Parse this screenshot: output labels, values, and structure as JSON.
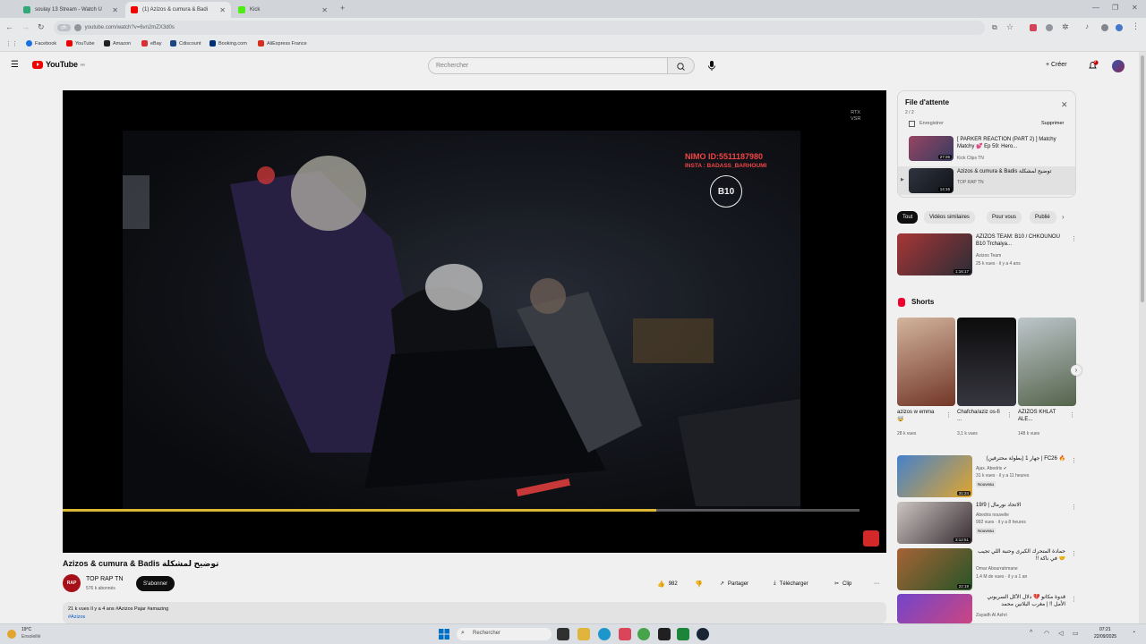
{
  "browser": {
    "tabs": [
      {
        "label": "soulay 13 Stream - Watch U",
        "color": "#36b37e"
      },
      {
        "label": "(1) Azizos & cumura & Badi",
        "color": "#ff0000"
      },
      {
        "label": "Kick",
        "color": "#53fc18"
      }
    ],
    "new_tab": "+",
    "url_chip": "gfk",
    "url": "youtube.com/watch?v=6vn2mZX3d0s",
    "bookmarks": [
      {
        "label": "Facebook",
        "color": "#1877f2"
      },
      {
        "label": "YouTube",
        "color": "#ff0000"
      },
      {
        "label": "Amazon",
        "color": "#222222"
      },
      {
        "label": "eBay",
        "color": "#e53238"
      },
      {
        "label": "Cdiscount",
        "color": "#1c4a8c"
      },
      {
        "label": "Booking.com",
        "color": "#003580"
      },
      {
        "label": "AliExpress France",
        "color": "#e43225"
      }
    ]
  },
  "header": {
    "logo": "YouTube",
    "logo_sup": "FR",
    "search_placeholder": "Rechercher",
    "create": "+ Créer",
    "notif_count": "9"
  },
  "player": {
    "rtx_badge": "RTX\nVSR",
    "overlay_id": "NIMO ID:5511187980",
    "overlay_insta": "INSTA : BADASS_BARHOUMI",
    "overlay_logo": "B10",
    "progress": 0.745
  },
  "video": {
    "title": "Azizos & cumura & Badis توضيح لمشكلة",
    "channel": "TOP RAP TN",
    "subs": "576 k abonnés",
    "avatar": "RAP",
    "subscribe": "S'abonner",
    "likes": "982",
    "share": "Partager",
    "download": "Télécharger",
    "clip": "Clip",
    "meta": "21 k vues  Il y a 4 ans  #Azizos Pajar #amazing",
    "hashtag": "#Azizos"
  },
  "queue": {
    "title": "File d'attente",
    "count": "2 / 2",
    "save": "Enregistrer",
    "remove": "Supprimer",
    "items": [
      {
        "title": "[ PARKER REACTION (PART 2) ] Matchy Matchy 💕 Ep 59: Hero...",
        "channel": "Kick Clips TN",
        "time": "27:26"
      },
      {
        "title": "Azizos & cumura & Badis توضيح لمشكلة",
        "channel": "TOP RAP TN",
        "time": "14:16"
      }
    ]
  },
  "filters": [
    "Tout",
    "Vidéos similaires",
    "Pour vous",
    "Publié"
  ],
  "recommend_top": {
    "title": "AZIZOS TEAM: B10 / CHKOUNOU B10 Trchaiya...",
    "channel": "Azizos Team",
    "meta": "25 k vues · il y a 4 ans",
    "time": "1:16:17"
  },
  "shorts": {
    "title": "Shorts",
    "items": [
      {
        "title": "azizos w emma 🤯",
        "views": "28 k vues"
      },
      {
        "title": "Chafcha/aziz os-fi ...",
        "views": "3,1 k vues"
      },
      {
        "title": "AZIZOS KHLAT ALE...",
        "views": "148 k vues"
      }
    ]
  },
  "recommend": [
    {
      "title": "🔥 FC26 | جهار 1 (بطولة محترفين)",
      "channel": "Ajax. Abedris ✔",
      "meta": "31 k vues · il y a 11 heures",
      "badge": "Nouveau",
      "time": "31:24"
    },
    {
      "title": "19/9 | الاتحاد نورمال",
      "channel": "Abedris nouvelle",
      "meta": "992 vues · il y a 8 heures",
      "badge": "Nouveau",
      "time": "3:12:51"
    },
    {
      "title": "حمادة المتحرك الكبرى وحنبة اللي تجيب 🤝 في ناكة !!",
      "channel": "Omar Abourrahmane",
      "meta": "1,4 M de vues · il y a 1 an",
      "badge": "",
      "time": "22:19"
    },
    {
      "title": "قدوة مكانو 💔 دلال الأكل السربوني الأمل !! | مغرب البلاتين محمد",
      "channel": "Zayadh Al Ashri",
      "meta": "",
      "badge": "",
      "time": ""
    }
  ],
  "taskbar": {
    "weather_temp": "19°C",
    "weather_desc": "Ensoleillé",
    "search": "Rechercher",
    "time": "07:21",
    "date": "22/09/2025"
  }
}
